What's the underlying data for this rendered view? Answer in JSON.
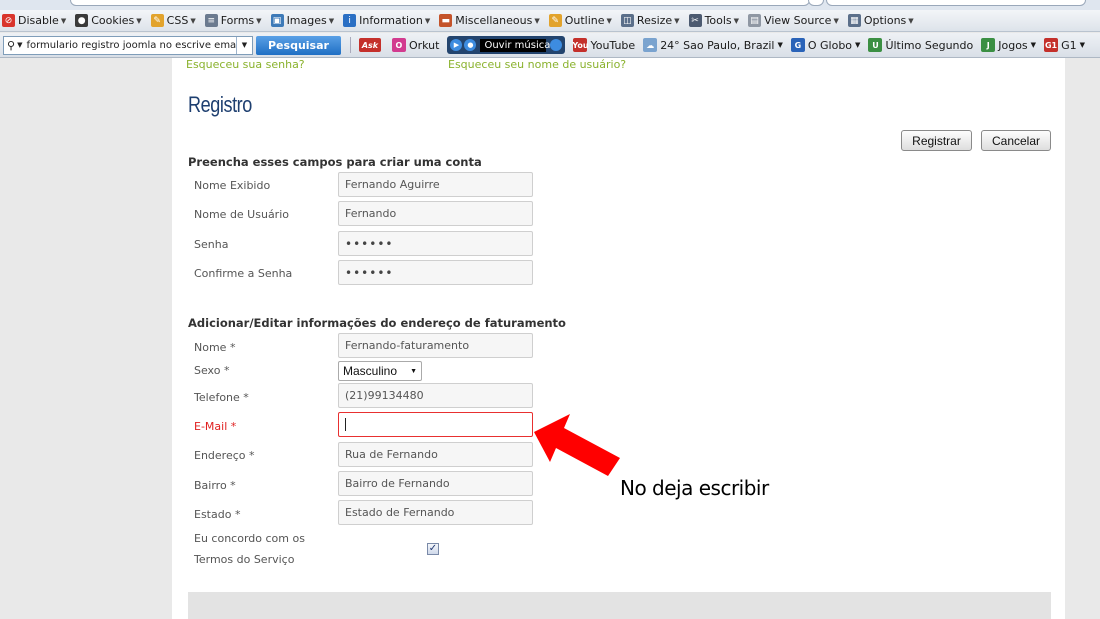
{
  "toolbar_top": {
    "items": [
      {
        "label": "Disable",
        "icon": "no-entry-icon",
        "color": "#d9342b"
      },
      {
        "label": "Cookies",
        "icon": "person-icon",
        "color": "#3a3a3a"
      },
      {
        "label": "CSS",
        "icon": "pencil-icon",
        "color": "#e2a32c"
      },
      {
        "label": "Forms",
        "icon": "form-icon",
        "color": "#6b7a8f"
      },
      {
        "label": "Images",
        "icon": "image-icon",
        "color": "#3d7ab8"
      },
      {
        "label": "Information",
        "icon": "info-icon",
        "color": "#2a6fc4"
      },
      {
        "label": "Miscellaneous",
        "icon": "box-icon",
        "color": "#c4532a"
      },
      {
        "label": "Outline",
        "icon": "pencil-icon",
        "color": "#e2a32c"
      },
      {
        "label": "Resize",
        "icon": "resize-icon",
        "color": "#5b6f8a"
      },
      {
        "label": "Tools",
        "icon": "tools-icon",
        "color": "#4c5a70"
      },
      {
        "label": "View Source",
        "icon": "document-icon",
        "color": "#8f97a3"
      },
      {
        "label": "Options",
        "icon": "options-icon",
        "color": "#5b6f8a"
      }
    ]
  },
  "toolbar_search": {
    "search_value": "formulario registro joomla no escrive emai",
    "search_button": "Pesquisar",
    "ask_label": "Ask",
    "orkut_label": "Orkut",
    "radio_label": "Ouvir música",
    "links": [
      {
        "label": "YouTube",
        "icon": "youtube-icon",
        "color": "#c4302b",
        "glyph": "You"
      },
      {
        "label": "24° Sao Paulo, Brazil",
        "icon": "weather-icon",
        "color": "#7aa3cf",
        "glyph": "☁",
        "caret": true
      },
      {
        "label": "O Globo",
        "icon": "globo-icon",
        "color": "#2a63b8",
        "glyph": "G",
        "caret": true
      },
      {
        "label": "Último Segundo",
        "icon": "news-icon",
        "color": "#3b8f43",
        "glyph": "U"
      },
      {
        "label": "Jogos",
        "icon": "games-icon",
        "color": "#3b8f43",
        "glyph": "J",
        "caret": true
      },
      {
        "label": "G1",
        "icon": "g1-icon",
        "color": "#c4302b",
        "glyph": "G1",
        "caret": true
      }
    ]
  },
  "page": {
    "forgot_password": "Esqueceu sua senha?",
    "forgot_username": "Esqueceu seu nome de usuário?",
    "title": "Registro",
    "register_button": "Registrar",
    "cancel_button": "Cancelar",
    "account_section": "Preencha esses campos para criar uma conta",
    "account_fields": {
      "display_name": {
        "label": "Nome Exibido",
        "value": "Fernando Aguirre"
      },
      "username": {
        "label": "Nome de Usuário",
        "value": "Fernando"
      },
      "password": {
        "label": "Senha",
        "value": "••••••"
      },
      "confirm_password": {
        "label": "Confirme a Senha",
        "value": "••••••"
      }
    },
    "billing_section": "Adicionar/Editar informações do endereço de faturamento",
    "billing_fields": {
      "name": {
        "label": "Nome *",
        "value": "Fernando-faturamento"
      },
      "sex": {
        "label": "Sexo *",
        "value": "Masculino"
      },
      "phone": {
        "label": "Telefone *",
        "value": "(21)99134480"
      },
      "email": {
        "label": "E-Mail *",
        "value": ""
      },
      "address": {
        "label": "Endereço *",
        "value": "Rua de Fernando"
      },
      "district": {
        "label": "Bairro *",
        "value": "Bairro de Fernando"
      },
      "state": {
        "label": "Estado *",
        "value": "Estado de Fernando"
      },
      "terms": {
        "label_line1": "Eu concordo com os",
        "label_line2": "Termos do Serviço",
        "checked": true
      }
    }
  },
  "annotation": {
    "text": "No deja escribir",
    "arrow_color": "#ff0000"
  }
}
